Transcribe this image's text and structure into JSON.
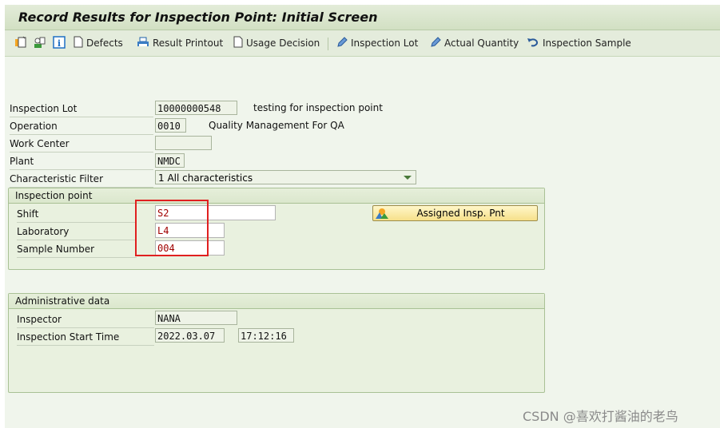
{
  "window": {
    "title": "Record Results for Inspection Point: Initial Screen"
  },
  "toolbar": {
    "icons": [
      "new-entry-icon",
      "person-settings-icon",
      "info-icon"
    ],
    "items": [
      {
        "label": "Defects",
        "icon": "document-icon"
      },
      {
        "label": "Result Printout",
        "icon": "printer-icon"
      },
      {
        "label": "Usage Decision",
        "icon": "document-icon"
      },
      {
        "label": "Inspection Lot",
        "icon": "pencil-icon"
      },
      {
        "label": "Actual Quantity",
        "icon": "pencil-icon"
      },
      {
        "label": "Inspection Sample",
        "icon": "undo-icon"
      }
    ]
  },
  "header_fields": {
    "inspection_lot": {
      "label": "Inspection Lot",
      "value": "10000000548",
      "description": "testing for inspection point"
    },
    "operation": {
      "label": "Operation",
      "value": "0010",
      "description": "Quality Management For QA"
    },
    "work_center": {
      "label": "Work Center",
      "value": ""
    },
    "plant": {
      "label": "Plant",
      "value": "NMDC"
    },
    "characteristic_filter": {
      "label": "Characteristic Filter",
      "value": "1 All characteristics"
    }
  },
  "inspection_point": {
    "title": "Inspection point",
    "shift": {
      "label": "Shift",
      "value": "S2"
    },
    "laboratory": {
      "label": "Laboratory",
      "value": "L4"
    },
    "sample_number": {
      "label": "Sample Number",
      "value": "004"
    },
    "assigned_button": "Assigned Insp. Pnt"
  },
  "administrative": {
    "title": "Administrative data",
    "inspector": {
      "label": "Inspector",
      "value": "NANA"
    },
    "start_time": {
      "label": "Inspection Start Time",
      "date": "2022.03.07",
      "time": "17:12:16"
    }
  },
  "watermark": "CSDN @喜欢打酱油的老鸟",
  "colors": {
    "highlight_box": "#e02020",
    "input_text": "#a00000"
  }
}
